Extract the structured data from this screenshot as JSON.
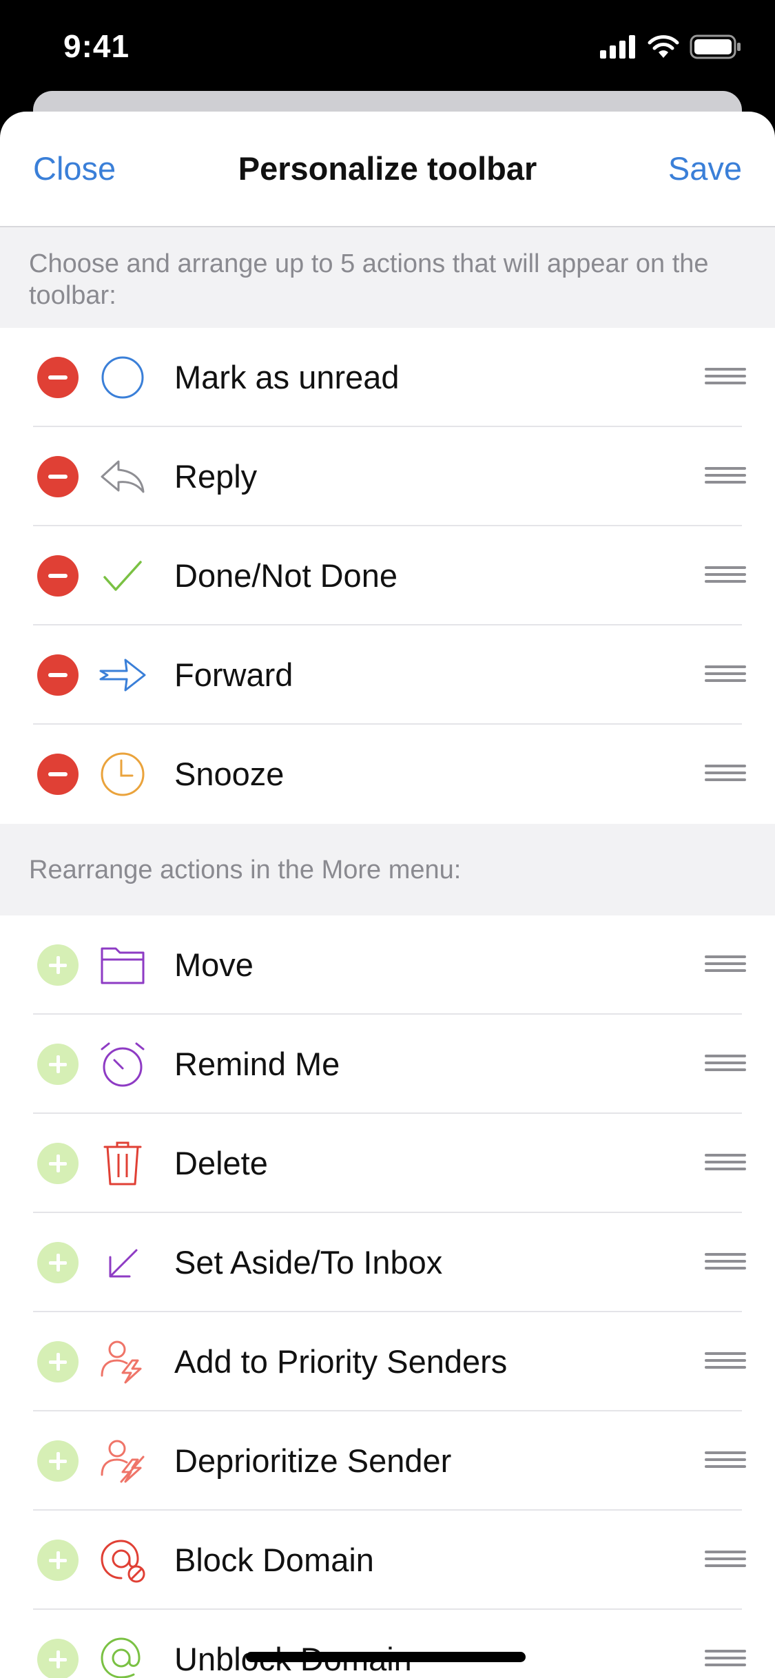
{
  "status": {
    "time": "9:41"
  },
  "nav": {
    "close": "Close",
    "title": "Personalize toolbar",
    "save": "Save"
  },
  "toolbar_section": {
    "header": "Choose and arrange up to 5 actions that will appear on the toolbar:",
    "items": [
      {
        "label": "Mark as unread",
        "icon": "circle-icon"
      },
      {
        "label": "Reply",
        "icon": "reply-arrow-icon"
      },
      {
        "label": "Done/Not Done",
        "icon": "checkmark-icon"
      },
      {
        "label": "Forward",
        "icon": "forward-arrow-icon"
      },
      {
        "label": "Snooze",
        "icon": "clock-icon"
      }
    ]
  },
  "more_section": {
    "header": "Rearrange actions in the More menu:",
    "items": [
      {
        "label": "Move",
        "icon": "folder-icon"
      },
      {
        "label": "Remind Me",
        "icon": "alarm-clock-icon"
      },
      {
        "label": "Delete",
        "icon": "trash-icon"
      },
      {
        "label": "Set Aside/To Inbox",
        "icon": "down-left-arrow-icon"
      },
      {
        "label": "Add to Priority Senders",
        "icon": "person-bolt-icon"
      },
      {
        "label": "Deprioritize Sender",
        "icon": "person-bolt-strike-icon"
      },
      {
        "label": "Block Domain",
        "icon": "at-block-icon"
      },
      {
        "label": "Unblock Domain",
        "icon": "at-icon"
      }
    ]
  },
  "colors": {
    "accent": "#3a7fd8",
    "remove": "#e04035",
    "add": "#d6efb5"
  }
}
